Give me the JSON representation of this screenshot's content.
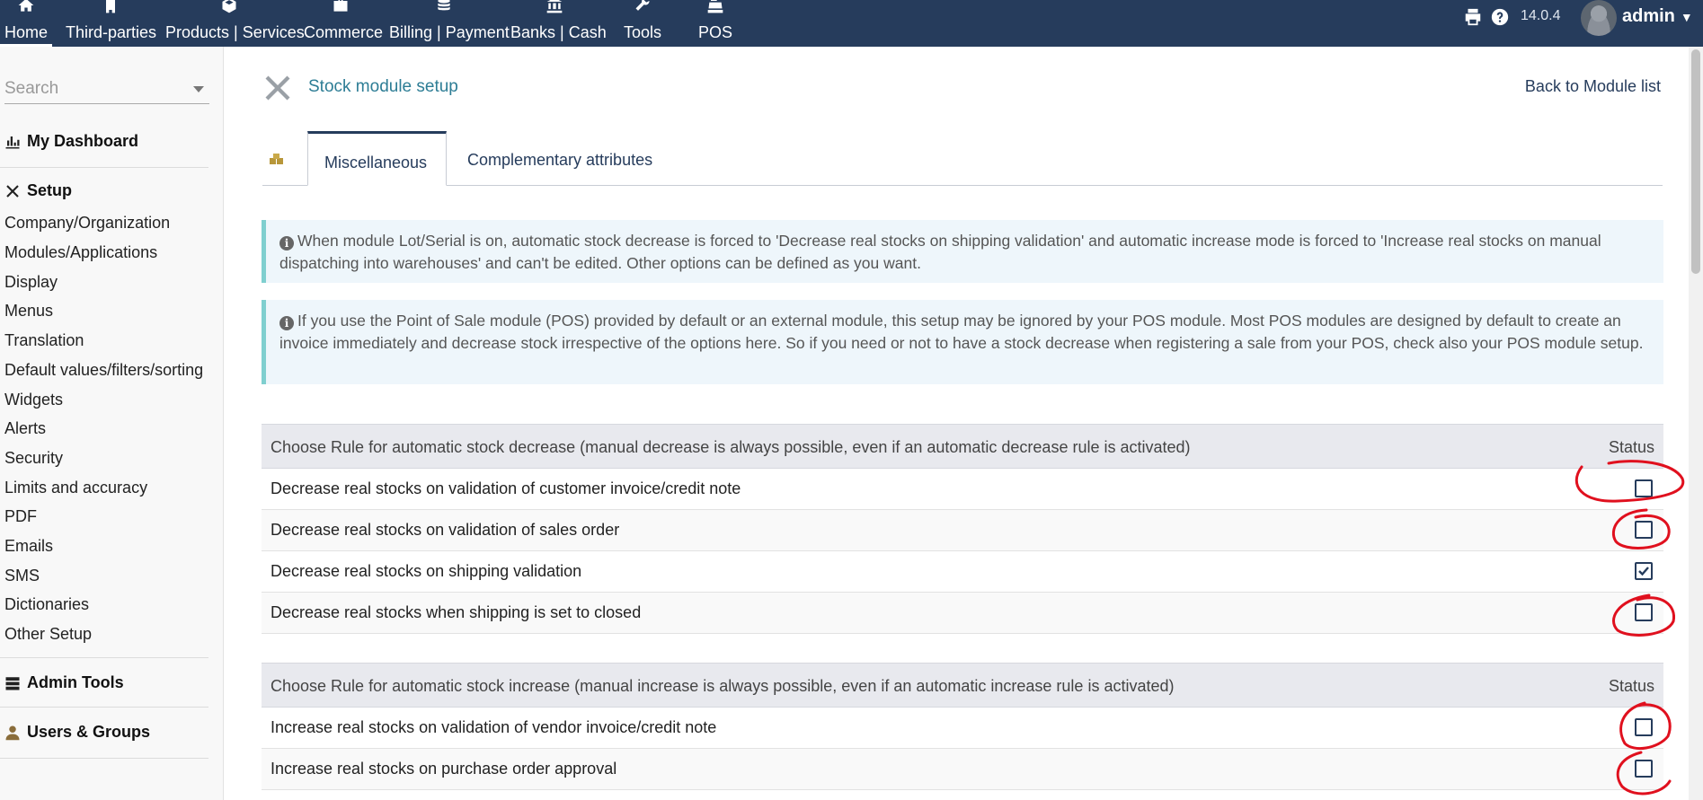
{
  "topnav": {
    "items": [
      {
        "label": "Home",
        "icon": "home-icon",
        "active": true
      },
      {
        "label": "Third-parties",
        "icon": "building-icon"
      },
      {
        "label": "Products | Services",
        "icon": "cube-icon"
      },
      {
        "label": "Commerce",
        "icon": "briefcase-icon"
      },
      {
        "label": "Billing | Payment",
        "icon": "coins-icon"
      },
      {
        "label": "Banks | Cash",
        "icon": "bank-icon"
      },
      {
        "label": "Tools",
        "icon": "wrench-icon"
      },
      {
        "label": "POS",
        "icon": "cash-register-icon"
      }
    ],
    "version": "14.0.4",
    "username": "admin"
  },
  "sidebar": {
    "search_placeholder": "Search",
    "dashboard": "My Dashboard",
    "setup_title": "Setup",
    "setup_items": [
      "Company/Organization",
      "Modules/Applications",
      "Display",
      "Menus",
      "Translation",
      "Default values/filters/sorting",
      "Widgets",
      "Alerts",
      "Security",
      "Limits and accuracy",
      "PDF",
      "Emails",
      "SMS",
      "Dictionaries",
      "Other Setup"
    ],
    "admin_tools": "Admin Tools",
    "users_groups": "Users & Groups"
  },
  "page": {
    "title": "Stock module setup",
    "back_link": "Back to Module list",
    "tabs": [
      {
        "label": "Miscellaneous",
        "active": true
      },
      {
        "label": "Complementary attributes",
        "active": false
      }
    ],
    "info1": "When module Lot/Serial is on, automatic stock decrease is forced to 'Decrease real stocks on shipping validation' and automatic increase mode is forced to 'Increase real stocks on manual dispatching into warehouses' and can't be edited. Other options can be defined as you want.",
    "info2": "If you use the Point of Sale module (POS) provided by default or an external module, this setup may be ignored by your POS module. Most POS modules are designed by default to create an invoice immediately and decrease stock irrespective of the options here. So if you need or not to have a stock decrease when registering a sale from your POS, check also your POS module setup."
  },
  "decrease_table": {
    "header": "Choose Rule for automatic stock decrease (manual decrease is always possible, even if an automatic decrease rule is activated)",
    "status_header": "Status",
    "rows": [
      {
        "label": "Decrease real stocks on validation of customer invoice/credit note",
        "checked": false
      },
      {
        "label": "Decrease real stocks on validation of sales order",
        "checked": false
      },
      {
        "label": "Decrease real stocks on shipping validation",
        "checked": true
      },
      {
        "label": "Decrease real stocks when shipping is set to closed",
        "checked": false
      }
    ]
  },
  "increase_table": {
    "header": "Choose Rule for automatic stock increase (manual increase is always possible, even if an automatic increase rule is activated)",
    "status_header": "Status",
    "rows": [
      {
        "label": "Increase real stocks on validation of vendor invoice/credit note",
        "checked": false
      },
      {
        "label": "Increase real stocks on purchase order approval",
        "checked": false
      }
    ]
  },
  "colors": {
    "topbar": "#263c5c",
    "title": "#2d7d95",
    "annotation": "#e0101e"
  }
}
